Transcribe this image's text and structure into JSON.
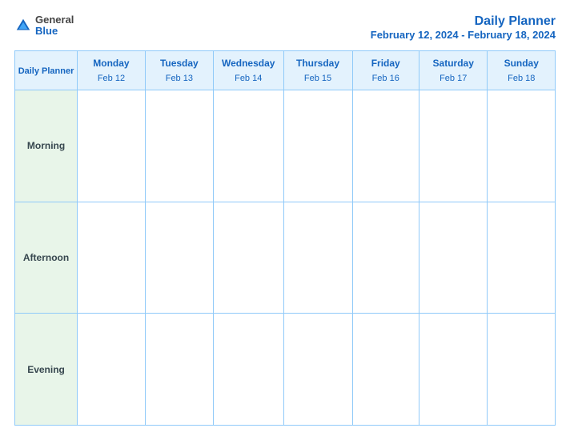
{
  "logo": {
    "general": "General",
    "blue": "Blue"
  },
  "header": {
    "title": "Daily Planner",
    "date_range": "February 12, 2024 - February 18, 2024"
  },
  "columns": [
    {
      "day": "Daily Planner",
      "date": ""
    },
    {
      "day": "Monday",
      "date": "Feb 12"
    },
    {
      "day": "Tuesday",
      "date": "Feb 13"
    },
    {
      "day": "Wednesday",
      "date": "Feb 14"
    },
    {
      "day": "Thursday",
      "date": "Feb 15"
    },
    {
      "day": "Friday",
      "date": "Feb 16"
    },
    {
      "day": "Saturday",
      "date": "Feb 17"
    },
    {
      "day": "Sunday",
      "date": "Feb 18"
    }
  ],
  "rows": [
    {
      "label": "Morning"
    },
    {
      "label": "Afternoon"
    },
    {
      "label": "Evening"
    }
  ]
}
